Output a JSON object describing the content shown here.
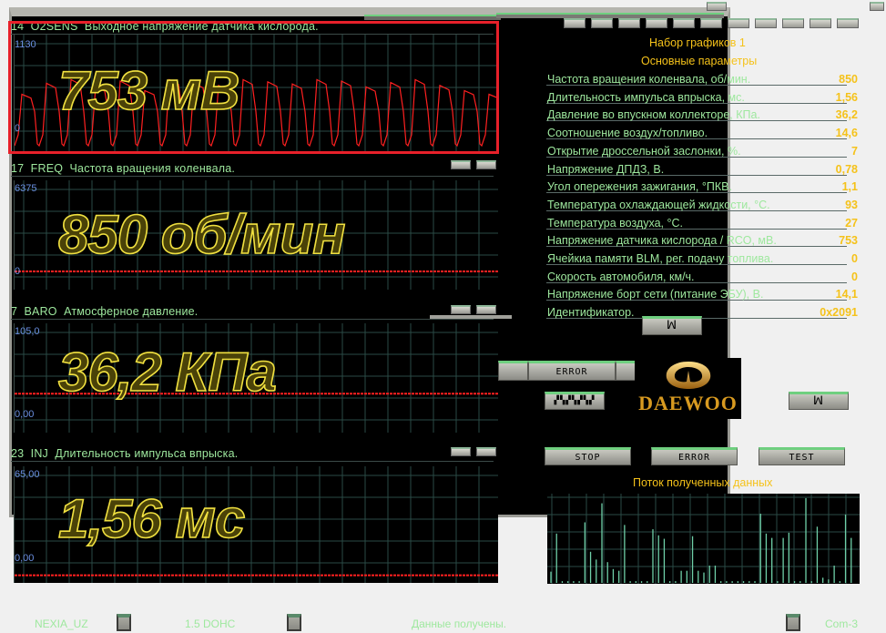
{
  "graphs": [
    {
      "label": "14  O2SENS  Выходное напряжение датчика кислорода.",
      "max": "1130",
      "min": "0",
      "reading": "753 мВ",
      "highlighted": true,
      "color": "#ff2020"
    },
    {
      "label": "17  FREQ  Частота вращения коленвала.",
      "max": "6375",
      "min": "0",
      "reading": "850 об/мин",
      "level": 0.13
    },
    {
      "label": "7  BARO  Атмосферное давление.",
      "max": "105,0",
      "min": "0,00",
      "reading": "36,2 КПа",
      "level": 0.34
    },
    {
      "label": "23  INJ  Длительность импульса впрыска.",
      "max": "65,00",
      "min": "0,00",
      "reading": "1,56 мс",
      "level": 0.02
    }
  ],
  "panel": {
    "set_title": "Набор графиков 1",
    "section_title": "Основные параметры"
  },
  "params": [
    {
      "label": "Частота вращения коленвала, об/мин.",
      "value": "850"
    },
    {
      "label": "Длительность импульса впрыска, мс.",
      "value": "1,56"
    },
    {
      "label": "Давление во впускном коллекторе, КПа.",
      "value": "36,2"
    },
    {
      "label": "Соотношение воздух/топливо.",
      "value": "14,6"
    },
    {
      "label": "Открытие дроссельной заслонки, %.",
      "value": "7"
    },
    {
      "label": "Напряжение ДПДЗ, В.",
      "value": "0,78"
    },
    {
      "label": "Угол опережения зажигания, °ПКВ.",
      "value": "1,1"
    },
    {
      "label": "Температура охлаждающей жидкости, °С.",
      "value": "93"
    },
    {
      "label": "Температура воздуха, °С.",
      "value": "27"
    },
    {
      "label": "Напряжение датчика кислорода / RCO, мВ.",
      "value": "753"
    },
    {
      "label": "Ячейкиа памяти BLM, рег. подачу топлива.",
      "value": "0"
    },
    {
      "label": "Скорость автомобиля, км/ч.",
      "value": "0"
    },
    {
      "label": "Напряжение борт сети (питание ЭБУ), В.",
      "value": "14,1"
    },
    {
      "label": "Идентификатор.",
      "value": "0x2091"
    }
  ],
  "buttons": {
    "error_top": "ERROR",
    "stop": "STOP",
    "error": "ERROR",
    "test": "TEST",
    "book_icon": "ꟽ"
  },
  "logo": {
    "text": "DAEWOO"
  },
  "stream": {
    "title": "Поток полученных данных",
    "values": [
      0.13,
      0.57,
      0.02,
      0.02,
      0.02,
      0.02,
      0.7,
      0.36,
      0.27,
      0.92,
      0.24,
      0.16,
      0.14,
      0.67,
      0.02,
      0.02,
      0.02,
      0.02,
      0.62,
      0.55,
      0.51,
      0.02,
      0.02,
      0.14,
      0.14,
      0.54,
      0.14,
      0.12,
      0.2,
      0.2,
      0.02,
      0.02,
      0.02,
      0.02,
      0.02,
      0.02,
      0.02,
      0.8,
      0.57,
      0.52,
      0.02,
      0.52,
      0.58,
      0.02,
      0.02,
      0.98,
      0.02,
      0.65,
      0.06,
      0.04,
      0.2,
      0.02,
      0.79,
      0.52
    ]
  },
  "footer": {
    "model": "NEXIA_UZ",
    "engine": "1.5 DOHC",
    "status": "Данные получены.",
    "port": "Com-3"
  },
  "colors": {
    "accent": "#f5c21a",
    "text": "#9ee89e",
    "trace": "#ff2020",
    "stream": "#6fd0a8"
  }
}
